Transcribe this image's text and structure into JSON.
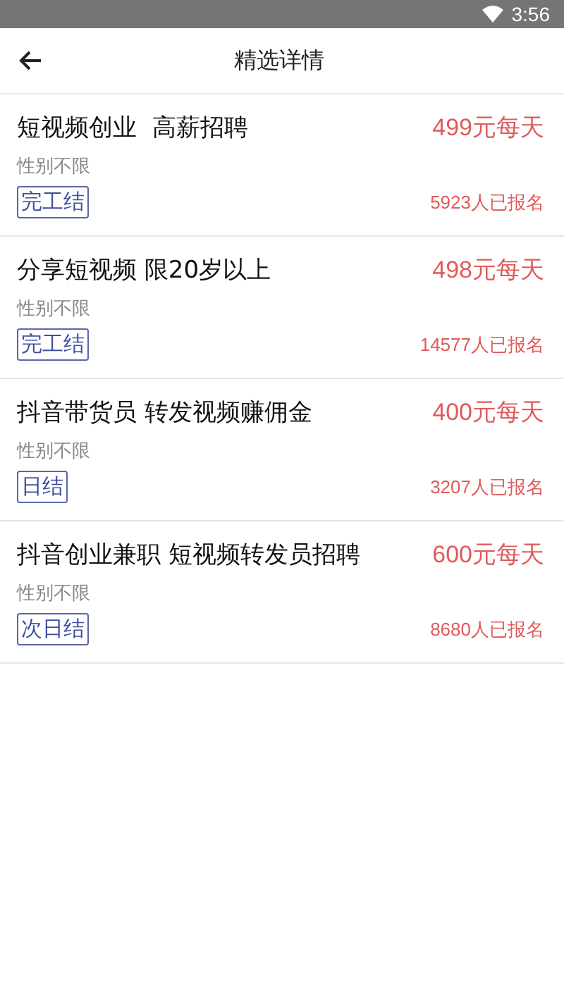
{
  "status_bar": {
    "time": "3:56"
  },
  "header": {
    "title": "精选详情"
  },
  "jobs": [
    {
      "title": "短视频创业  高薪招聘",
      "price": "499元每天",
      "gender": "性别不限",
      "tag": "完工结",
      "applicants": "5923人已报名"
    },
    {
      "title": "分享短视频 限20岁以上",
      "price": "498元每天",
      "gender": "性别不限",
      "tag": "完工结",
      "applicants": "14577人已报名"
    },
    {
      "title": "抖音带货员 转发视频赚佣金",
      "price": "400元每天",
      "gender": "性别不限",
      "tag": "日结",
      "applicants": "3207人已报名"
    },
    {
      "title": "抖音创业兼职 短视频转发员招聘",
      "price": "600元每天",
      "gender": "性别不限",
      "tag": "次日结",
      "applicants": "8680人已报名"
    }
  ]
}
